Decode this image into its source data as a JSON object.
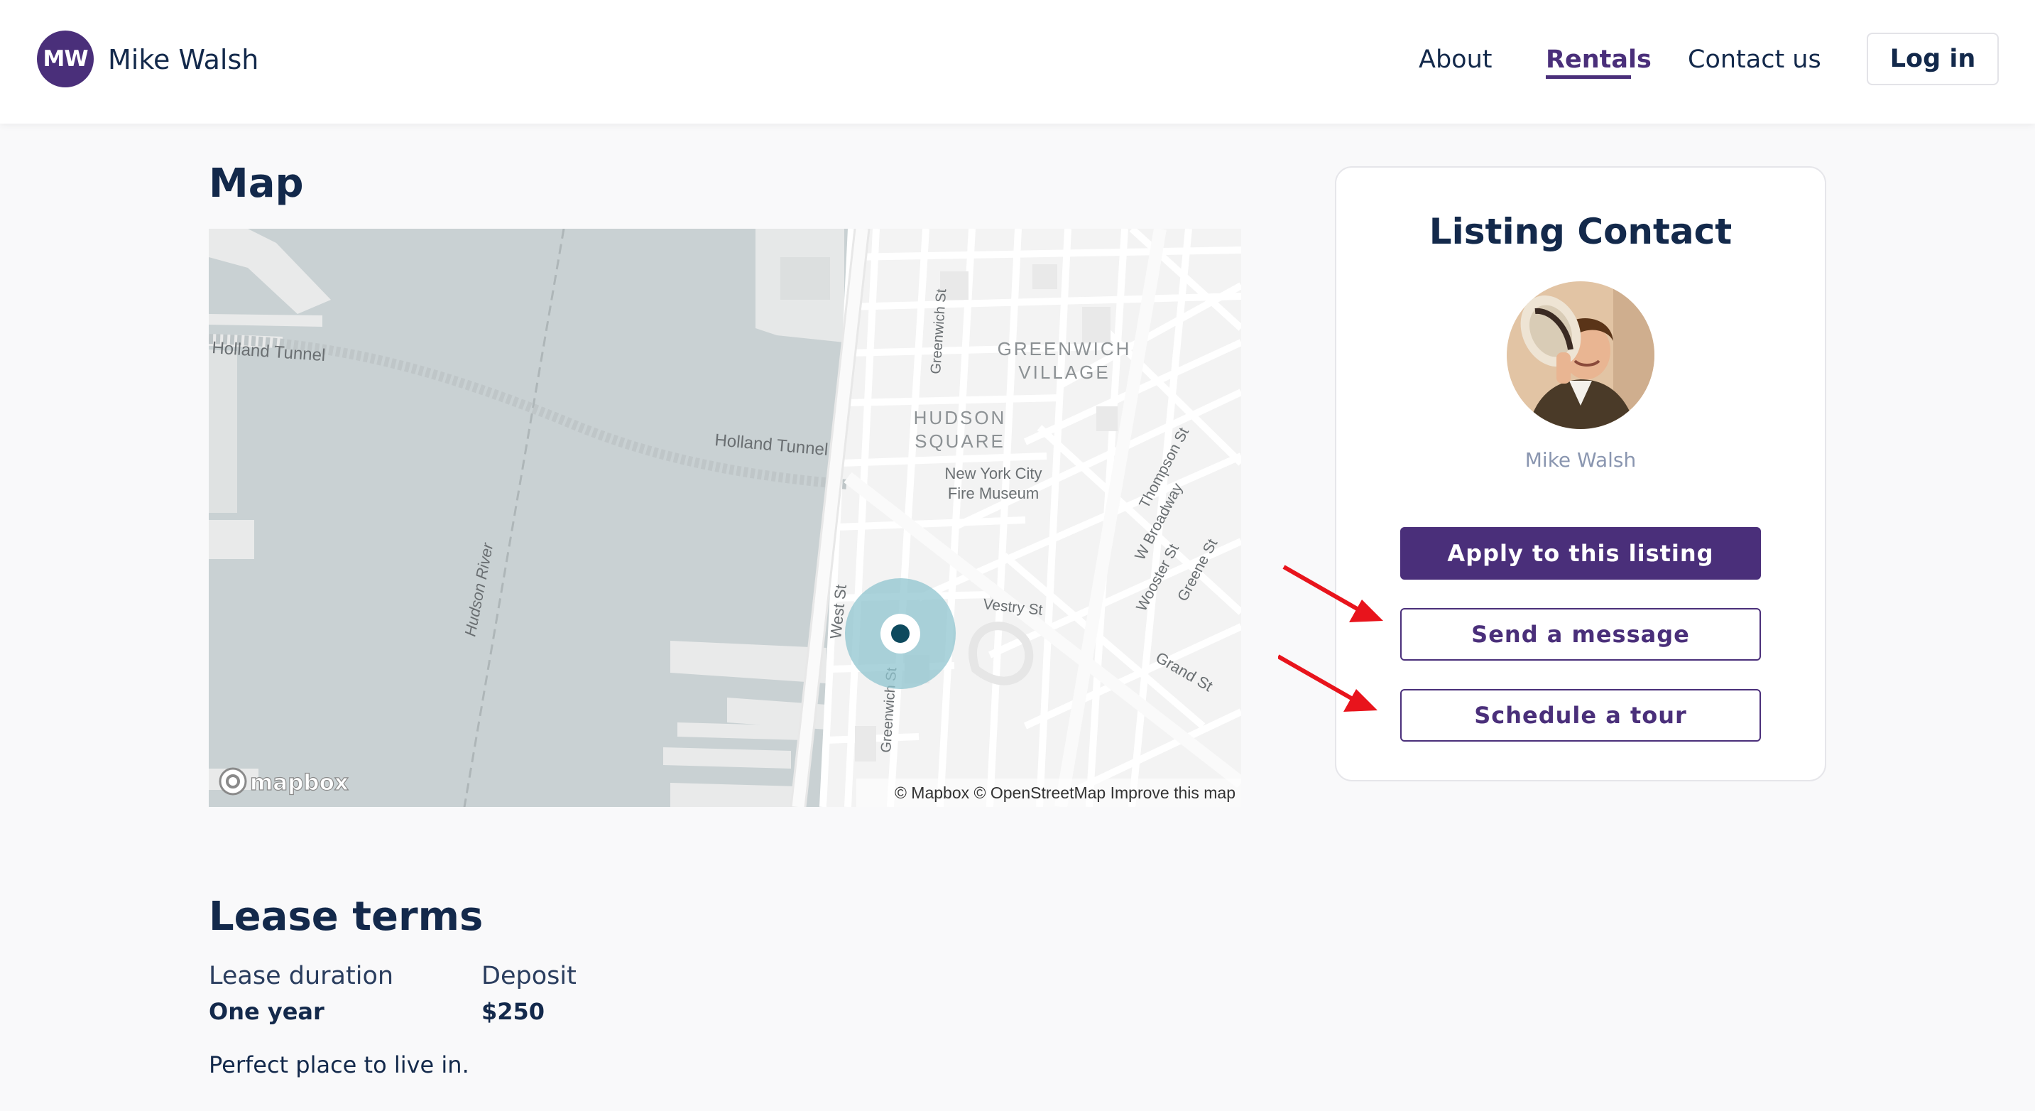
{
  "header": {
    "avatar_initials": "MW",
    "brand_name": "Mike Walsh",
    "nav": {
      "about": "About",
      "rentals": "Rentals",
      "contact": "Contact us"
    },
    "login_label": "Log in"
  },
  "map_section": {
    "title": "Map",
    "map": {
      "labels": {
        "holland_tunnel_left": "Holland Tunnel",
        "holland_tunnel_right": "Holland Tunnel",
        "hudson_river": "Hudson River",
        "greenwich_st_top": "Greenwich St",
        "greenwich_village_1": "GREENWICH",
        "greenwich_village_2": "VILLAGE",
        "hudson_square_1": "HUDSON",
        "hudson_square_2": "SQUARE",
        "fire_museum_1": "New York City",
        "fire_museum_2": "Fire Museum",
        "thompson_st": "Thompson St",
        "w_broadway": "W Broadway",
        "wooster_st": "Wooster St",
        "greene_st": "Greene St",
        "grand_st": "Grand St",
        "vestry_st": "Vestry St",
        "west_st": "West St",
        "greenwich_st_bottom": "Greenwich St"
      },
      "logo_text": "mapbox",
      "attribution": "© Mapbox © OpenStreetMap Improve this map",
      "colors": {
        "water": "#c9d1d3",
        "land": "#f3f3f3",
        "marker_halo": "#8fc4cf",
        "marker_dot": "#0e4a5e"
      }
    }
  },
  "contact_card": {
    "title": "Listing Contact",
    "name": "Mike Walsh",
    "apply_label": "Apply to this listing",
    "message_label": "Send a message",
    "tour_label": "Schedule a tour"
  },
  "lease": {
    "title": "Lease terms",
    "duration_label": "Lease duration",
    "duration_value": "One year",
    "deposit_label": "Deposit",
    "deposit_value": "$250",
    "description": "Perfect place to live in."
  },
  "colors": {
    "brand": "#4a2f7a",
    "text": "#13294b",
    "annotation_arrow": "#e8141c"
  },
  "icons": [
    "avatar-initials",
    "mapbox-logo-icon",
    "location-marker-icon",
    "annotation-arrow-icon"
  ]
}
